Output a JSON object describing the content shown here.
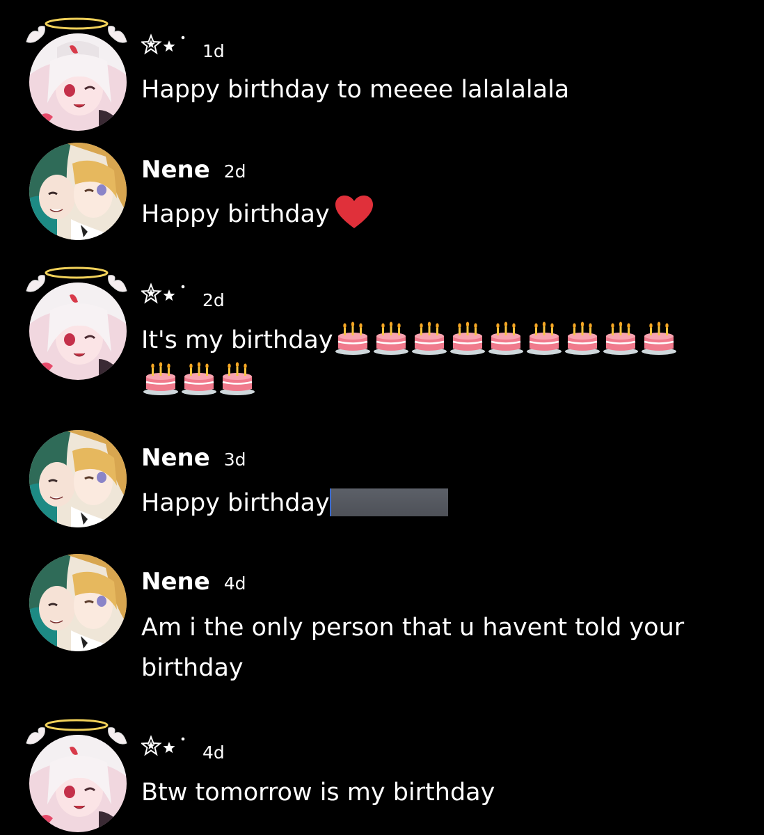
{
  "messages": [
    {
      "author": "★★˙",
      "author_kind": "stars",
      "avatar": "angel-avatar",
      "time": "1d",
      "text": "Happy birthday to meeee lalalalala"
    },
    {
      "author": "Nene",
      "author_kind": "name",
      "avatar": "nene-avatar",
      "time": "2d",
      "text": "Happy birthday",
      "trailing_icon": "red-heart-icon"
    },
    {
      "author": "★★˙",
      "author_kind": "stars",
      "avatar": "angel-avatar",
      "time": "2d",
      "text": "It's my birthday",
      "cake_count": 12,
      "trailing_icon": "birthday-cake-icon"
    },
    {
      "author": "Nene",
      "author_kind": "name",
      "avatar": "nene-avatar",
      "time": "3d",
      "text": "Happy birthday",
      "redacted": true
    },
    {
      "author": "Nene",
      "author_kind": "name",
      "avatar": "nene-avatar",
      "time": "4d",
      "text": "Am i the only person that u havent told your birthday"
    },
    {
      "author": "★★˙",
      "author_kind": "stars",
      "avatar": "angel-avatar",
      "time": "4d",
      "text": "Btw tomorrow is my birthday"
    }
  ],
  "colors": {
    "background": "#000000",
    "text": "#ffffff",
    "heart": "#e0303a",
    "cake": "#f07a8c",
    "redaction": "#565a62"
  }
}
